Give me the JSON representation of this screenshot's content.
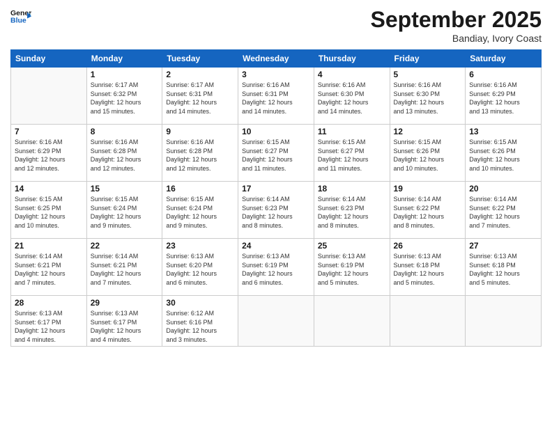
{
  "logo": {
    "line1": "General",
    "line2": "Blue"
  },
  "title": "September 2025",
  "subtitle": "Bandiay, Ivory Coast",
  "weekdays": [
    "Sunday",
    "Monday",
    "Tuesday",
    "Wednesday",
    "Thursday",
    "Friday",
    "Saturday"
  ],
  "weeks": [
    [
      {
        "day": "",
        "info": ""
      },
      {
        "day": "1",
        "info": "Sunrise: 6:17 AM\nSunset: 6:32 PM\nDaylight: 12 hours\nand 15 minutes."
      },
      {
        "day": "2",
        "info": "Sunrise: 6:17 AM\nSunset: 6:31 PM\nDaylight: 12 hours\nand 14 minutes."
      },
      {
        "day": "3",
        "info": "Sunrise: 6:16 AM\nSunset: 6:31 PM\nDaylight: 12 hours\nand 14 minutes."
      },
      {
        "day": "4",
        "info": "Sunrise: 6:16 AM\nSunset: 6:30 PM\nDaylight: 12 hours\nand 14 minutes."
      },
      {
        "day": "5",
        "info": "Sunrise: 6:16 AM\nSunset: 6:30 PM\nDaylight: 12 hours\nand 13 minutes."
      },
      {
        "day": "6",
        "info": "Sunrise: 6:16 AM\nSunset: 6:29 PM\nDaylight: 12 hours\nand 13 minutes."
      }
    ],
    [
      {
        "day": "7",
        "info": "Sunrise: 6:16 AM\nSunset: 6:29 PM\nDaylight: 12 hours\nand 12 minutes."
      },
      {
        "day": "8",
        "info": "Sunrise: 6:16 AM\nSunset: 6:28 PM\nDaylight: 12 hours\nand 12 minutes."
      },
      {
        "day": "9",
        "info": "Sunrise: 6:16 AM\nSunset: 6:28 PM\nDaylight: 12 hours\nand 12 minutes."
      },
      {
        "day": "10",
        "info": "Sunrise: 6:15 AM\nSunset: 6:27 PM\nDaylight: 12 hours\nand 11 minutes."
      },
      {
        "day": "11",
        "info": "Sunrise: 6:15 AM\nSunset: 6:27 PM\nDaylight: 12 hours\nand 11 minutes."
      },
      {
        "day": "12",
        "info": "Sunrise: 6:15 AM\nSunset: 6:26 PM\nDaylight: 12 hours\nand 10 minutes."
      },
      {
        "day": "13",
        "info": "Sunrise: 6:15 AM\nSunset: 6:26 PM\nDaylight: 12 hours\nand 10 minutes."
      }
    ],
    [
      {
        "day": "14",
        "info": "Sunrise: 6:15 AM\nSunset: 6:25 PM\nDaylight: 12 hours\nand 10 minutes."
      },
      {
        "day": "15",
        "info": "Sunrise: 6:15 AM\nSunset: 6:24 PM\nDaylight: 12 hours\nand 9 minutes."
      },
      {
        "day": "16",
        "info": "Sunrise: 6:15 AM\nSunset: 6:24 PM\nDaylight: 12 hours\nand 9 minutes."
      },
      {
        "day": "17",
        "info": "Sunrise: 6:14 AM\nSunset: 6:23 PM\nDaylight: 12 hours\nand 8 minutes."
      },
      {
        "day": "18",
        "info": "Sunrise: 6:14 AM\nSunset: 6:23 PM\nDaylight: 12 hours\nand 8 minutes."
      },
      {
        "day": "19",
        "info": "Sunrise: 6:14 AM\nSunset: 6:22 PM\nDaylight: 12 hours\nand 8 minutes."
      },
      {
        "day": "20",
        "info": "Sunrise: 6:14 AM\nSunset: 6:22 PM\nDaylight: 12 hours\nand 7 minutes."
      }
    ],
    [
      {
        "day": "21",
        "info": "Sunrise: 6:14 AM\nSunset: 6:21 PM\nDaylight: 12 hours\nand 7 minutes."
      },
      {
        "day": "22",
        "info": "Sunrise: 6:14 AM\nSunset: 6:21 PM\nDaylight: 12 hours\nand 7 minutes."
      },
      {
        "day": "23",
        "info": "Sunrise: 6:13 AM\nSunset: 6:20 PM\nDaylight: 12 hours\nand 6 minutes."
      },
      {
        "day": "24",
        "info": "Sunrise: 6:13 AM\nSunset: 6:19 PM\nDaylight: 12 hours\nand 6 minutes."
      },
      {
        "day": "25",
        "info": "Sunrise: 6:13 AM\nSunset: 6:19 PM\nDaylight: 12 hours\nand 5 minutes."
      },
      {
        "day": "26",
        "info": "Sunrise: 6:13 AM\nSunset: 6:18 PM\nDaylight: 12 hours\nand 5 minutes."
      },
      {
        "day": "27",
        "info": "Sunrise: 6:13 AM\nSunset: 6:18 PM\nDaylight: 12 hours\nand 5 minutes."
      }
    ],
    [
      {
        "day": "28",
        "info": "Sunrise: 6:13 AM\nSunset: 6:17 PM\nDaylight: 12 hours\nand 4 minutes."
      },
      {
        "day": "29",
        "info": "Sunrise: 6:13 AM\nSunset: 6:17 PM\nDaylight: 12 hours\nand 4 minutes."
      },
      {
        "day": "30",
        "info": "Sunrise: 6:12 AM\nSunset: 6:16 PM\nDaylight: 12 hours\nand 3 minutes."
      },
      {
        "day": "",
        "info": ""
      },
      {
        "day": "",
        "info": ""
      },
      {
        "day": "",
        "info": ""
      },
      {
        "day": "",
        "info": ""
      }
    ]
  ]
}
